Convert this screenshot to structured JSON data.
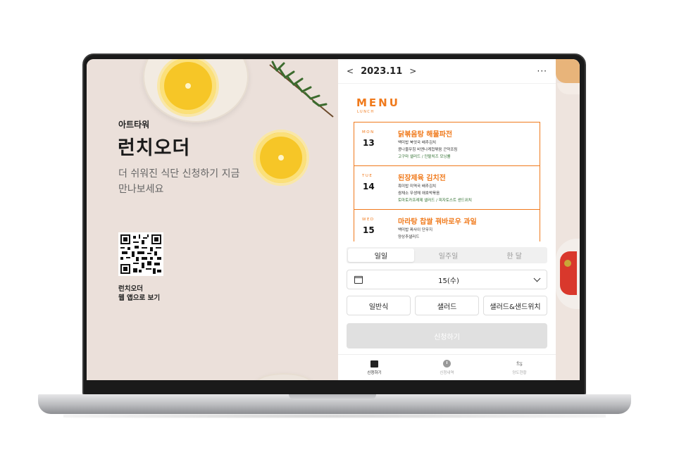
{
  "left_panel": {
    "brand_sub": "아트타워",
    "brand_title": "런치오더",
    "tagline": "더 쉬워진 식단 신청하기 지금 만나보세요",
    "qr_caption_line1": "런치오더",
    "qr_caption_line2": "웹 앱으로 보기"
  },
  "app": {
    "header": {
      "prev": "<",
      "month": "2023.11",
      "next": ">",
      "more": "···"
    },
    "menu": {
      "title": "MENU",
      "subtitle": "LUNCH",
      "days": [
        {
          "dow": "MON",
          "date": "13",
          "main": "닭볶음탕 해물파전",
          "sides": [
            "백미밥 북엇국 배추김치",
            "콩나물무침 비엔나케첩볶음 곤약조림"
          ],
          "extra": "고구마 샐러드 / 단팥치즈 모닝롤"
        },
        {
          "dow": "TUE",
          "date": "14",
          "main": "된장제육 김치전",
          "sides": [
            "흑미밥 미역국 배추김치",
            "쌈채소 무생채 애호박볶음"
          ],
          "extra": "토마토카프레제 샐러드 / 피자토스트 샌드위치"
        },
        {
          "dow": "WED",
          "date": "15",
          "main": "마라탕 찹쌀 꿔바로우 과일",
          "sides": [
            "백미밥 짜사이 단무지",
            "양상추샐러드"
          ],
          "extra": ""
        }
      ]
    },
    "tabs": [
      "일일",
      "일주일",
      "한 달"
    ],
    "active_tab": "일일",
    "date_select": {
      "value": "15(수)",
      "icon": "calendar-icon"
    },
    "options": [
      "일반식",
      "샐러드",
      "샐러드&샌드위치"
    ],
    "submit_label": "신청하기",
    "bottom_nav": [
      {
        "label": "신청하기",
        "icon": "calendar-icon",
        "active": true
      },
      {
        "label": "신청내역",
        "icon": "clock-icon",
        "active": false
      },
      {
        "label": "양도현황",
        "icon": "swap-icon",
        "active": false
      }
    ]
  },
  "colors": {
    "accent": "#f07a1c",
    "green_text": "#2f6f2f",
    "left_bg": "#ebe0da",
    "disabled_button": "#e0e0e0"
  }
}
